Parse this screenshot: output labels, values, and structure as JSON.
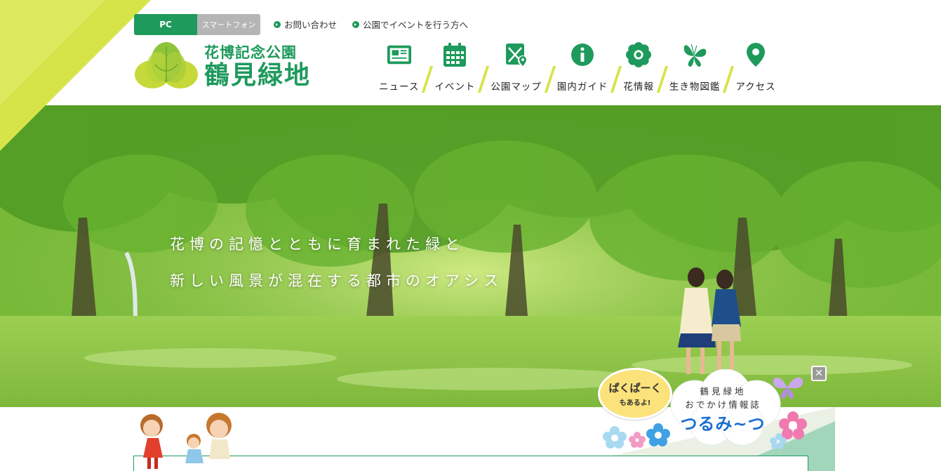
{
  "header": {
    "toggle": {
      "pc_label": "PC",
      "sp_label": "スマートフォン"
    },
    "links": [
      {
        "label": "お問い合わせ"
      },
      {
        "label": "公園でイベントを行う方へ"
      }
    ],
    "logo": {
      "sub": "花博記念公園",
      "main": "鶴見緑地"
    }
  },
  "nav": [
    {
      "label": "ニュース",
      "icon": "newspaper-icon"
    },
    {
      "label": "イベント",
      "icon": "calendar-icon"
    },
    {
      "label": "公園マップ",
      "icon": "map-icon"
    },
    {
      "label": "園内ガイド",
      "icon": "info-icon"
    },
    {
      "label": "花情報",
      "icon": "flower-icon"
    },
    {
      "label": "生き物図鑑",
      "icon": "butterfly-icon"
    },
    {
      "label": "アクセス",
      "icon": "location-pin-icon"
    }
  ],
  "hero": {
    "caption_line1": "花博の記憶とともに育まれた緑と",
    "caption_line2": "新しい風景が混在する都市のオアシス"
  },
  "promo": {
    "bubble_line1": "ぱくぱーく",
    "bubble_line2": "もあるよ!",
    "title_line1": "鶴見緑地",
    "title_line2": "おでかけ情報誌",
    "title_main": "つるみ~つ",
    "close_label": "✕"
  },
  "colors": {
    "brand_green": "#1e9a5c",
    "accent_yellow_green": "#d6e44a",
    "toggle_inactive": "#b5b5b5"
  }
}
